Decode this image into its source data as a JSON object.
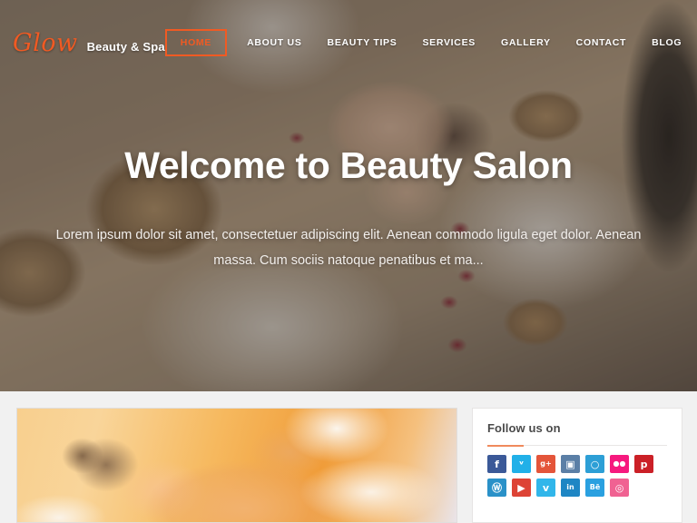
{
  "brand": {
    "mark": "Glow",
    "tagline": "Beauty & Spa",
    "accent_color": "#f05a23"
  },
  "nav": {
    "items": [
      {
        "label": "HOME",
        "active": true
      },
      {
        "label": "ABOUT US",
        "active": false
      },
      {
        "label": "BEAUTY TIPS",
        "active": false
      },
      {
        "label": "SERVICES",
        "active": false
      },
      {
        "label": "GALLERY",
        "active": false
      },
      {
        "label": "CONTACT",
        "active": false
      },
      {
        "label": "BLOG",
        "active": false
      }
    ]
  },
  "hero": {
    "title": "Welcome to Beauty Salon",
    "subtitle": "Lorem ipsum dolor sit amet, consectetuer adipiscing elit. Aenean commodo ligula eget dolor. Aenean massa. Cum sociis natoque penatibus et ma...",
    "image_alt": "spa-treatment-singing-bowls-rose-petals"
  },
  "feature": {
    "image_alt": "massage-therapy-photo"
  },
  "sidebar": {
    "follow_widget": {
      "title": "Follow us on",
      "accent_color": "#f08a5d",
      "icons": [
        {
          "name": "facebook-icon",
          "glyph": "f",
          "color": "#3b5998"
        },
        {
          "name": "twitter-icon",
          "glyph": "ᵛ",
          "color": "#21b0e8"
        },
        {
          "name": "google-plus-icon",
          "glyph": "g+",
          "color": "#e4553a"
        },
        {
          "name": "instagram-icon",
          "glyph": "▣",
          "color": "#5b7fa6"
        },
        {
          "name": "github-icon",
          "glyph": "○",
          "color": "#2d9fd6"
        },
        {
          "name": "flickr-icon",
          "glyph": "●●",
          "color": "#f6197e"
        },
        {
          "name": "pinterest-icon",
          "glyph": "p",
          "color": "#cb2027"
        },
        {
          "name": "wordpress-icon",
          "glyph": "Ⓦ",
          "color": "#2a91c8"
        },
        {
          "name": "youtube-icon",
          "glyph": "▶",
          "color": "#dd4335"
        },
        {
          "name": "vimeo-icon",
          "glyph": "v",
          "color": "#31b6ea"
        },
        {
          "name": "linkedin-icon",
          "glyph": "in",
          "color": "#1e86c4"
        },
        {
          "name": "behance-icon",
          "glyph": "Bē",
          "color": "#2aa0e0"
        },
        {
          "name": "dribbble-icon",
          "glyph": "◎",
          "color": "#f06292"
        }
      ]
    }
  }
}
